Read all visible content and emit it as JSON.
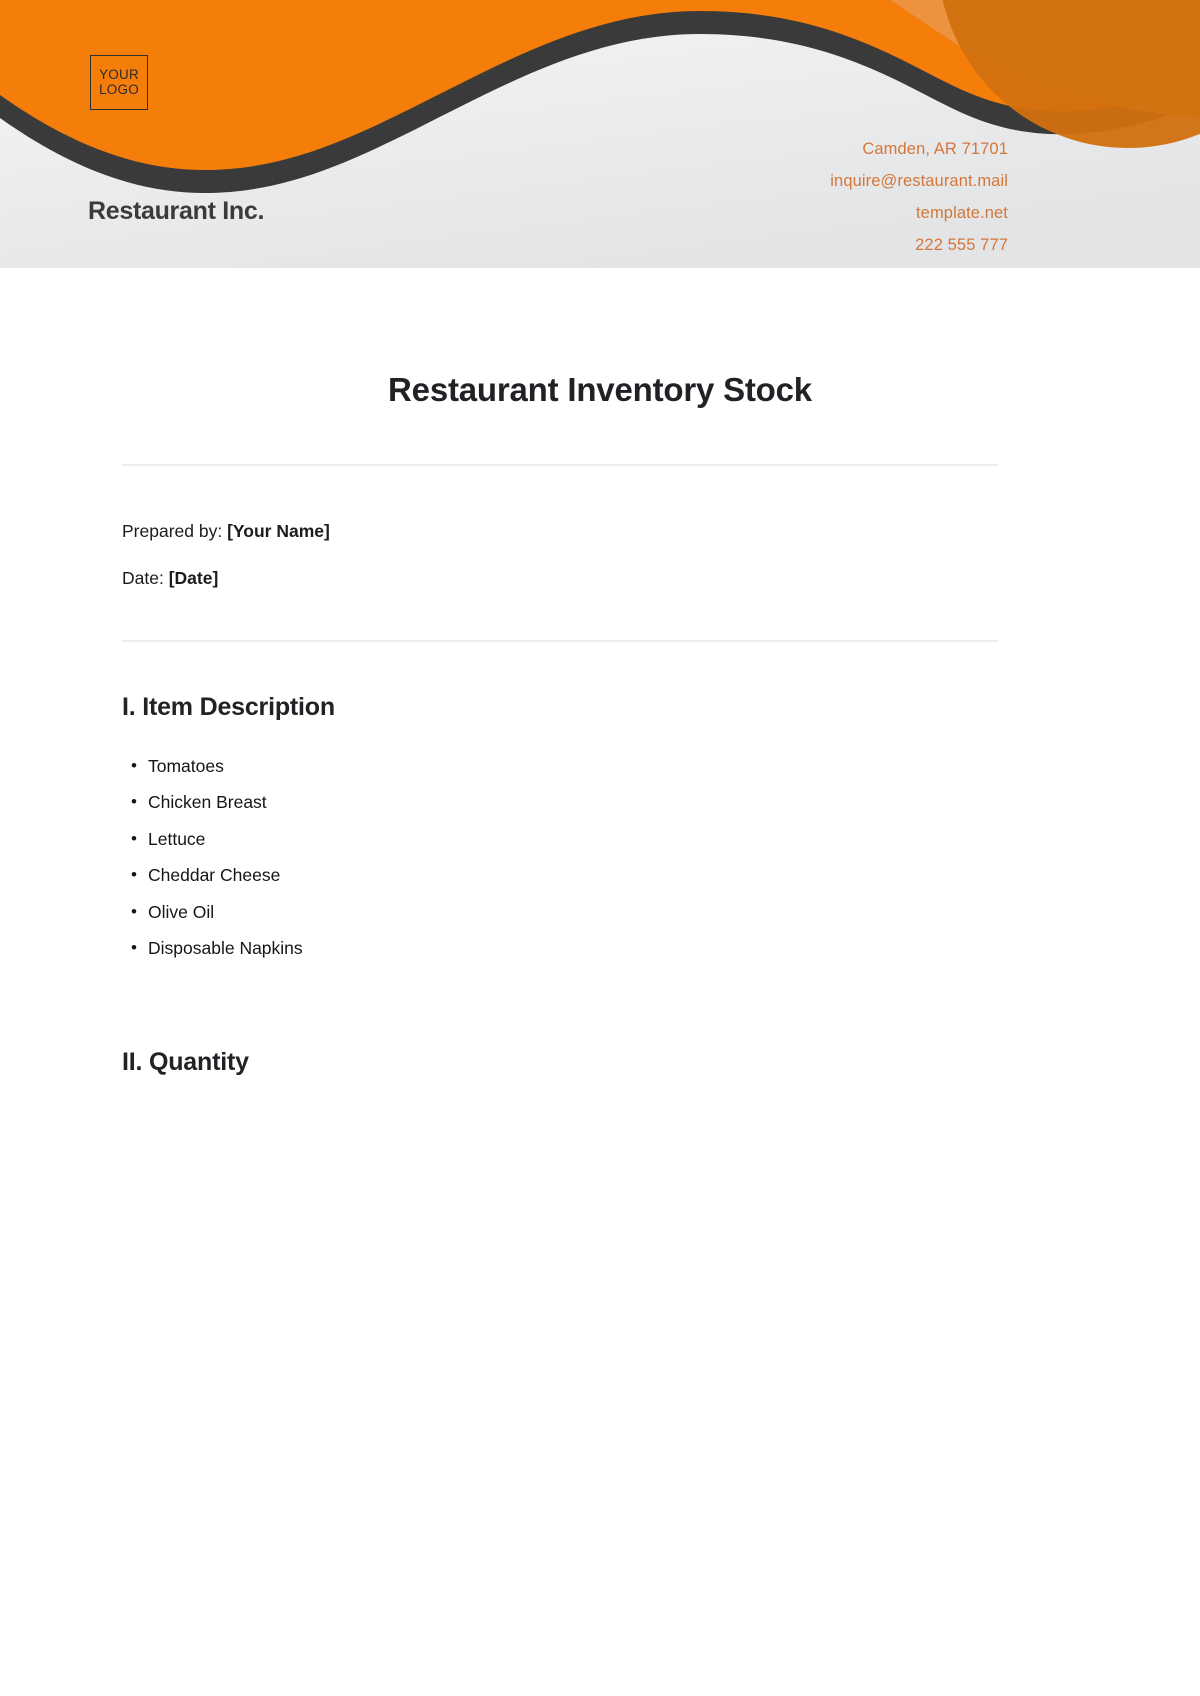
{
  "header": {
    "logo": {
      "line1": "YOUR",
      "line2": "LOGO"
    },
    "company_name": "Restaurant Inc.",
    "contact": {
      "address": "Camden, AR 71701",
      "email": "inquire@restaurant.mail",
      "website": "template.net",
      "phone": "222 555 777"
    },
    "colors": {
      "orange_primary": "#F57E0B",
      "orange_dark": "#D2700F",
      "orange_light": "#ED9340",
      "wave_dark": "#3A3A3A",
      "contact_text": "#D4773A",
      "band_background": "#ECEDED"
    }
  },
  "document": {
    "title": "Restaurant Inventory Stock",
    "prepared_by_label": "Prepared by:",
    "prepared_by_value": "[Your Name]",
    "date_label": "Date:",
    "date_value": "[Date]"
  },
  "sections": [
    {
      "heading": "I. Item Description",
      "items": [
        "Tomatoes",
        "Chicken Breast",
        "Lettuce",
        "Cheddar Cheese",
        "Olive Oil",
        "Disposable Napkins"
      ]
    },
    {
      "heading": "II. Quantity",
      "items": []
    }
  ]
}
